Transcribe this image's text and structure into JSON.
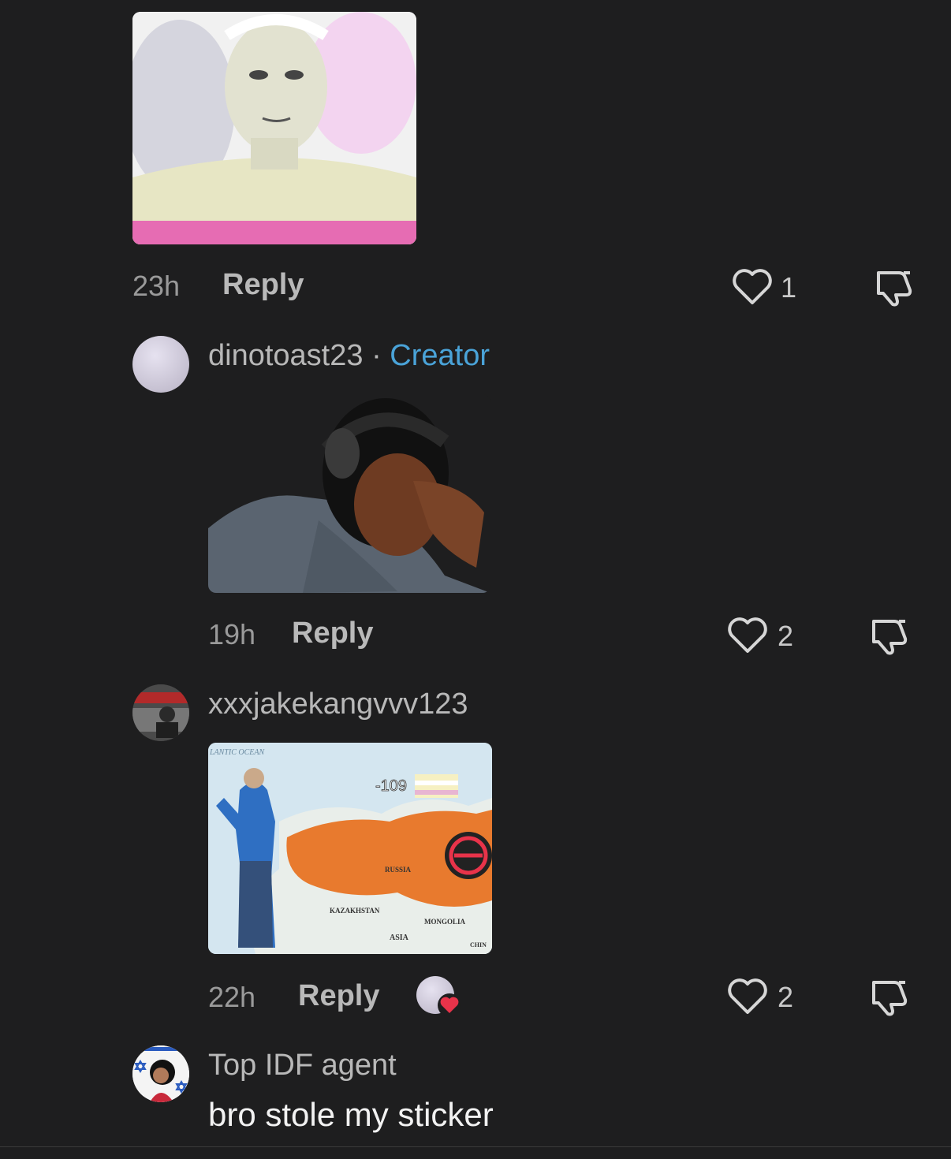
{
  "comments": [
    {
      "time": "23h",
      "reply_label": "Reply",
      "likes": "1",
      "media": "sticker-glowing-man",
      "icons": [
        "heart-icon",
        "dislike-icon"
      ]
    },
    {
      "username": "dinotoast23",
      "separator": "·",
      "badge": "Creator",
      "time": "19h",
      "reply_label": "Reply",
      "likes": "2",
      "media": "sticker-facepalm",
      "icons": [
        "heart-icon",
        "dislike-icon"
      ]
    },
    {
      "username": "xxxjakekangvvv123",
      "time": "22h",
      "reply_label": "Reply",
      "likes": "2",
      "media": {
        "type": "map-sticker",
        "labels": [
          "LANTIC OCEAN",
          "-109",
          "RUSSIA",
          "KAZAKHSTAN",
          "MONGOLIA",
          "ASIA",
          "CHIN"
        ]
      },
      "creator_liked": true,
      "icons": [
        "heart-icon",
        "dislike-icon"
      ]
    },
    {
      "username": "Top IDF agent",
      "text": "bro stole my sticker"
    }
  ],
  "colors": {
    "background": "#1e1e1f",
    "creator_badge": "#4aa3d8",
    "liked_heart": "#e8334a",
    "map_orange": "#e87a2e",
    "map_water": "#cfe3ee"
  }
}
